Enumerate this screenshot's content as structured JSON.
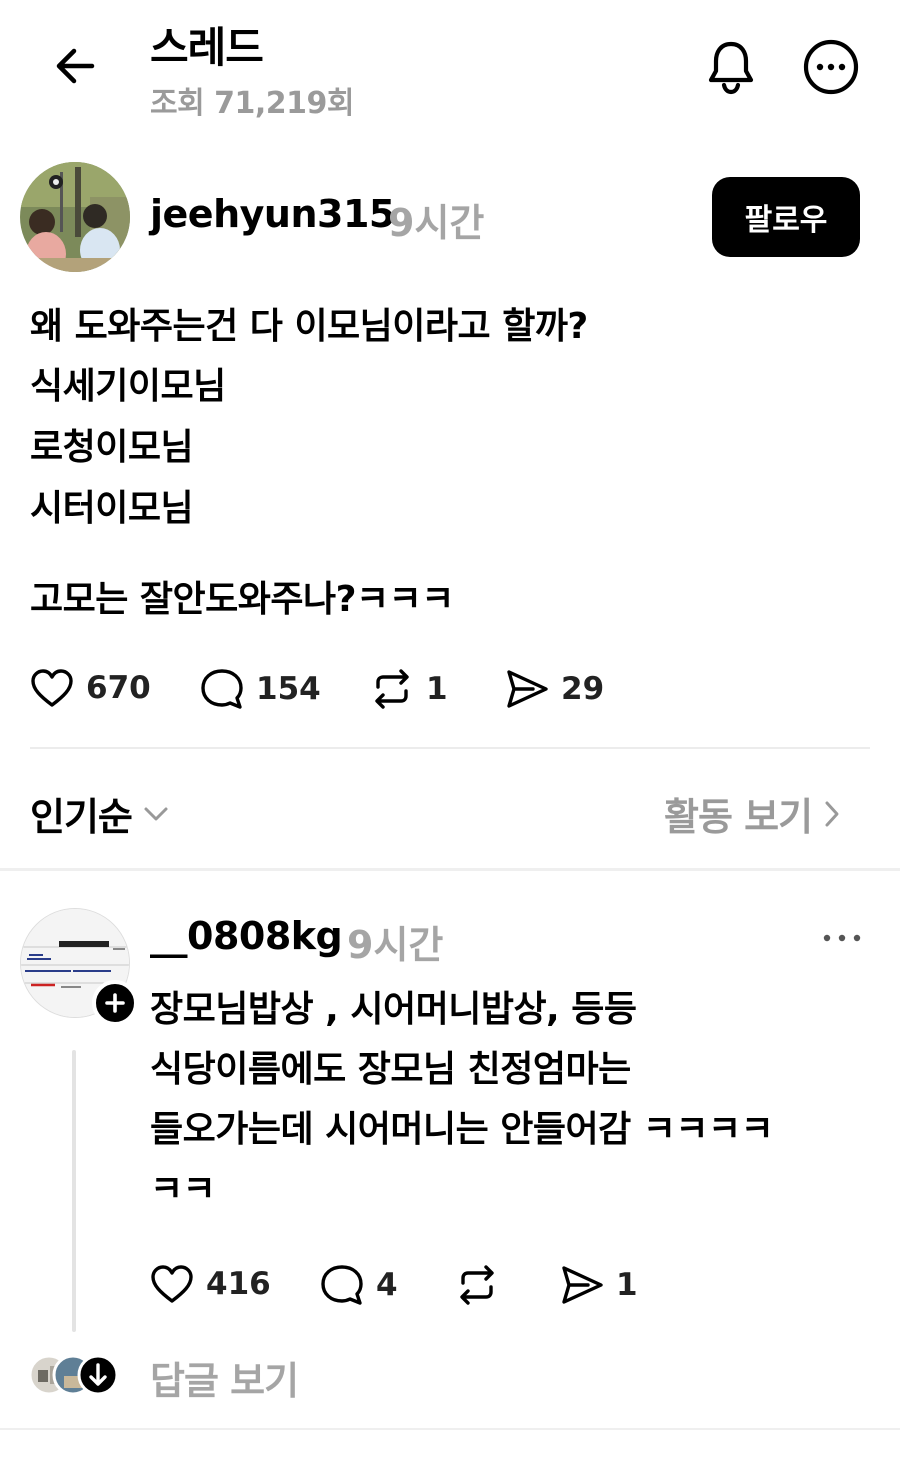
{
  "header": {
    "title": "스레드",
    "views": "조회 71,219회",
    "back_icon": "arrow-left-icon",
    "bell_icon": "bell-icon",
    "more_icon": "more-circle-icon"
  },
  "post": {
    "username": "jeehyun315",
    "time": "9시간",
    "follow_label": "팔로우",
    "lines": [
      "왜 도와주는건 다 이모님이라고 할까?",
      "식세기이모님",
      "로청이모님",
      "시터이모님",
      "고모는 잘안도와주나?ㅋㅋㅋ"
    ],
    "actions": {
      "likes": "670",
      "comments": "154",
      "reposts": "1",
      "shares": "29"
    }
  },
  "sort": {
    "label": "인기순",
    "activity_label": "활동 보기"
  },
  "comment": {
    "username": "__0808kg",
    "time": "9시간",
    "lines": [
      "장모님밥상 , 시어머니밥상, 등등",
      "식당이름에도 장모님 친정엄마는",
      "들오가는데 시어머니는 안들어감 ㅋㅋㅋㅋ",
      "ㅋㅋ"
    ],
    "actions": {
      "likes": "416",
      "comments": "4",
      "reposts": "",
      "shares": "1"
    },
    "replies_label": "답글 보기"
  },
  "colors": {
    "text": "#000000",
    "muted": "#9a9a9a",
    "divider": "#ececec",
    "button_bg": "#000000",
    "button_text": "#ffffff"
  }
}
